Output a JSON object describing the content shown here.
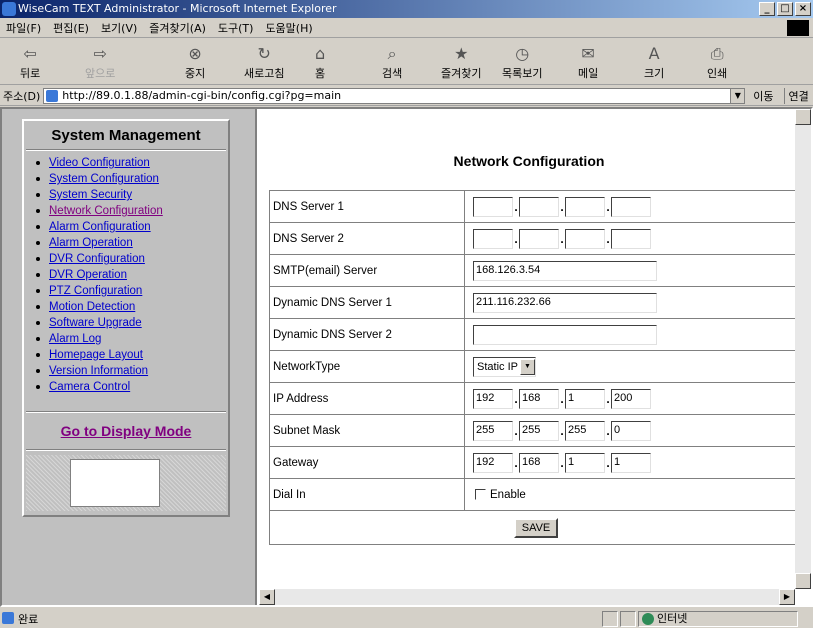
{
  "window": {
    "title": "WiseCam TEXT Administrator - Microsoft Internet Explorer"
  },
  "menu": [
    "파일(F)",
    "편집(E)",
    "보기(V)",
    "즐겨찾기(A)",
    "도구(T)",
    "도움말(H)"
  ],
  "toolbar": {
    "back": "뒤로",
    "forward": "앞으로",
    "stop": "중지",
    "refresh": "새로고침",
    "home": "홈",
    "search": "검색",
    "favorites": "즐겨찾기",
    "history": "목록보기",
    "mail": "메일",
    "size": "크기",
    "print": "인쇄"
  },
  "address": {
    "label": "주소(D)",
    "url": "http://89.0.1.88/admin-cgi-bin/config.cgi?pg=main",
    "go": "이동",
    "links": "연결"
  },
  "sidebar": {
    "title": "System Management",
    "items": [
      "Video Configuration",
      "System Configuration",
      "System Security",
      "Network Configuration",
      "Alarm Configuration",
      "Alarm Operation",
      "DVR Configuration",
      "DVR Operation",
      "PTZ Configuration",
      "Motion Detection",
      "Software Upgrade",
      "Alarm Log",
      "Homepage Layout",
      "Version Information",
      "Camera Control"
    ],
    "display_mode": "Go to Display Mode"
  },
  "main": {
    "title": "Network Configuration",
    "labels": {
      "dns1": "DNS Server 1",
      "dns2": "DNS Server 2",
      "smtp": "SMTP(email) Server",
      "ddns1": "Dynamic DNS Server 1",
      "ddns2": "Dynamic DNS Server 2",
      "nettype": "NetworkType",
      "ip": "IP Address",
      "mask": "Subnet Mask",
      "gateway": "Gateway",
      "dialin": "Dial In"
    },
    "values": {
      "dns1": [
        "",
        "",
        "",
        ""
      ],
      "dns2": [
        "",
        "",
        "",
        ""
      ],
      "smtp": "168.126.3.54",
      "ddns1": "211.116.232.66",
      "ddns2": "",
      "nettype": "Static IP",
      "ip": [
        "192",
        "168",
        "1",
        "200"
      ],
      "mask": [
        "255",
        "255",
        "255",
        "0"
      ],
      "gateway": [
        "192",
        "168",
        "1",
        "1"
      ]
    },
    "dialin_option": "Enable",
    "save": "SAVE"
  },
  "status": {
    "left": "완료",
    "zone": "인터넷"
  }
}
